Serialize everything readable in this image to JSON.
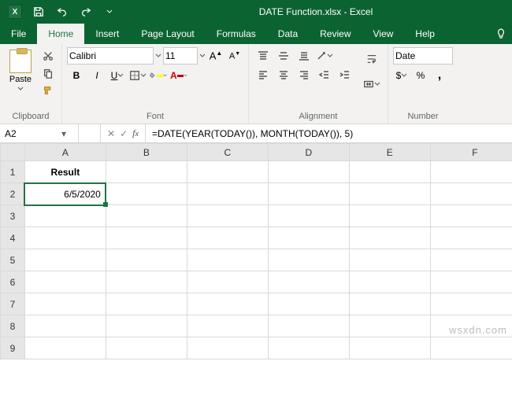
{
  "title": "DATE Function.xlsx - Excel",
  "tabs": {
    "file": "File",
    "home": "Home",
    "insert": "Insert",
    "page_layout": "Page Layout",
    "formulas": "Formulas",
    "data": "Data",
    "review": "Review",
    "view": "View",
    "help": "Help"
  },
  "ribbon": {
    "clipboard": {
      "paste": "Paste",
      "label": "Clipboard"
    },
    "font": {
      "label": "Font",
      "name": "Calibri",
      "size": "11",
      "bold": "B",
      "italic": "I",
      "underline": "U",
      "increase": "A",
      "decrease": "A"
    },
    "alignment": {
      "label": "Alignment"
    },
    "number": {
      "label": "Number",
      "format": "Date"
    }
  },
  "namebox": "A2",
  "formula": "=DATE(YEAR(TODAY()), MONTH(TODAY()), 5)",
  "columns": [
    "A",
    "B",
    "C",
    "D",
    "E",
    "F"
  ],
  "rows": [
    "1",
    "2",
    "3",
    "4",
    "5",
    "6",
    "7",
    "8",
    "9"
  ],
  "cells": {
    "A1": "Result",
    "A2": "6/5/2020"
  },
  "watermark": "wsxdn.com"
}
